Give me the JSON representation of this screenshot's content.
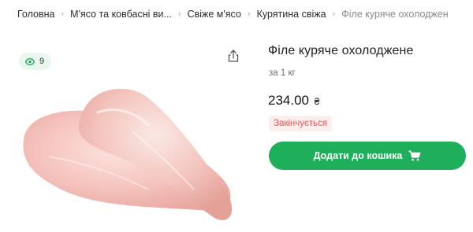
{
  "breadcrumb": {
    "items": [
      "Головна",
      "М'ясо та ковбасні ви...",
      "Свіже м'ясо",
      "Курятина свіжа",
      "Філе куряче охолоджен"
    ]
  },
  "product": {
    "views_count": "9",
    "title": "Філе куряче охолоджене",
    "unit": "за 1 кг",
    "price": "234.00",
    "currency": "₴",
    "status": "Закінчується",
    "add_to_cart_label": "Додати до кошика"
  },
  "icons": {
    "views": "eye-icon",
    "share": "share-icon",
    "cart": "cart-icon",
    "separator": "chevron-right-icon"
  },
  "colors": {
    "accent": "#1fae5a",
    "views_badge_bg": "#eaf7ef",
    "status_text": "#e25a5a",
    "status_bg": "#fdeeee"
  }
}
